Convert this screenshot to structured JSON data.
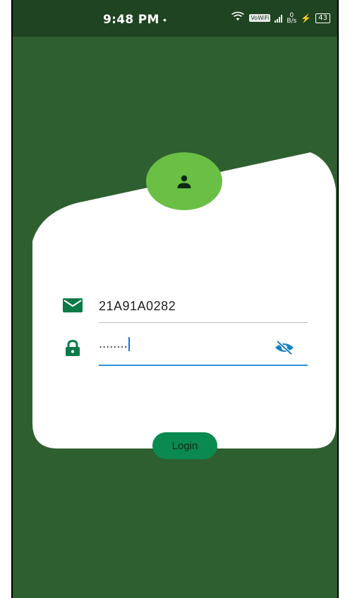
{
  "status_bar": {
    "time": "9:48 PM",
    "dot": "•",
    "volte": "VoWiFi",
    "net_speed_value": "0",
    "net_speed_unit": "B/s",
    "charging_symbol": "⚡",
    "battery": "43"
  },
  "login": {
    "email_value": "21A91A0282",
    "password_masked": "........",
    "login_label": "Login"
  },
  "colors": {
    "background": "#2e5f30",
    "status_bar": "#1f4421",
    "card": "#ffffff",
    "avatar": "#6abf45",
    "icon_green": "#0b7a47",
    "login_button": "#0b8a4f",
    "focus_underline": "#2d8fd8"
  },
  "icons": [
    "wifi-icon",
    "signal-icon",
    "user-icon",
    "email-icon",
    "lock-icon",
    "visibility-off-icon"
  ]
}
